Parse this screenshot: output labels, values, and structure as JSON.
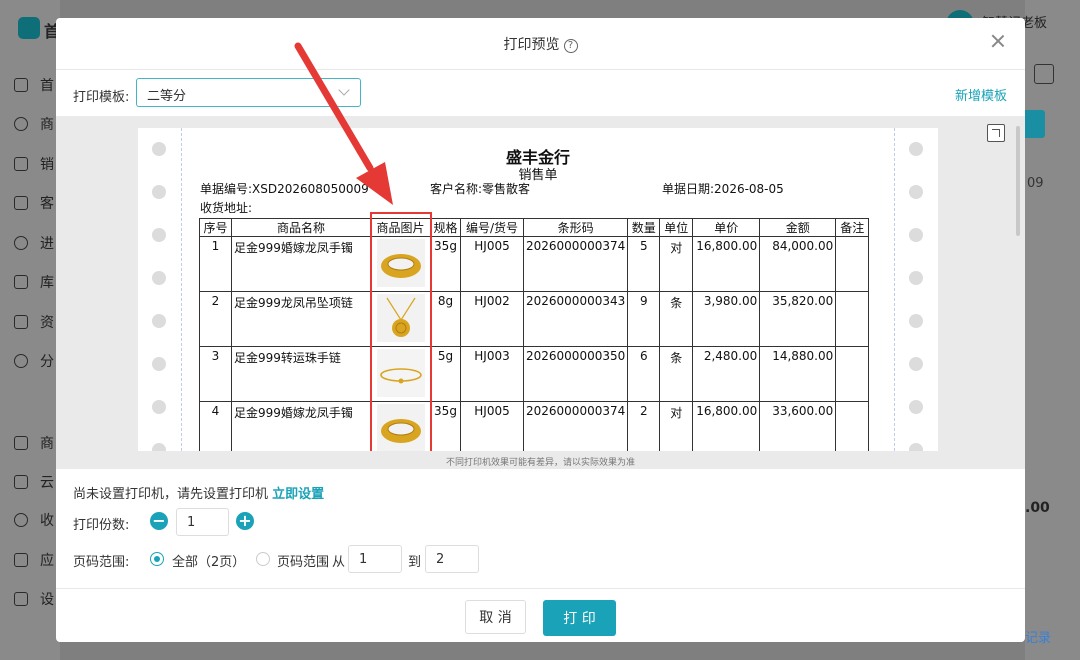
{
  "app": {
    "logo_text": "首",
    "user_name": "智慧记老板",
    "sidebar": [
      "首",
      "商",
      "销",
      "客",
      "进",
      "库",
      "资",
      "分",
      "商",
      "云",
      "收",
      "应",
      "设"
    ],
    "right_value_1": "09",
    "right_value_2": ".00",
    "right_link": "记录"
  },
  "modal": {
    "title": "打印预览",
    "help_glyph": "?",
    "template_label": "打印模板:",
    "template_value": "二等分",
    "add_template": "新增模板",
    "paper_note": "不同打印机效果可能有差异，请以实际效果为准",
    "printer_note": "尚未设置打印机，请先设置打印机",
    "printer_setup_link": "立即设置",
    "copies_label": "打印份数:",
    "copies_value": "1",
    "minus": "−",
    "plus": "+",
    "range_label": "页码范围:",
    "range_all": "全部（2页）",
    "range_custom": "页码范围",
    "range_from": "从",
    "range_to": "到",
    "page_from": "1",
    "page_to": "2",
    "cancel": "取 消",
    "print": "打 印"
  },
  "document": {
    "company": "盛丰金行",
    "doc_type": "销售单",
    "doc_no": "单据编号:XSD202608050009",
    "customer": "客户名称:零售散客",
    "date": "单据日期:2026-08-05",
    "address": "收货地址:",
    "columns": [
      "序号",
      "商品名称",
      "商品图片",
      "规格",
      "编号/货号",
      "条形码",
      "数量",
      "单位",
      "单价",
      "金额",
      "备注"
    ],
    "rows": [
      {
        "no": "1",
        "name": "足金999婚嫁龙凤手镯",
        "spec": "35g",
        "code": "HJ005",
        "barcode": "2026000000374",
        "qty": "5",
        "unit": "对",
        "price": "16,800.00",
        "amount": "84,000.00",
        "remark": "",
        "image": "gold-bangle-icon"
      },
      {
        "no": "2",
        "name": "足金999龙凤吊坠项链",
        "spec": "8g",
        "code": "HJ002",
        "barcode": "2026000000343",
        "qty": "9",
        "unit": "条",
        "price": "3,980.00",
        "amount": "35,820.00",
        "remark": "",
        "image": "gold-pendant-icon"
      },
      {
        "no": "3",
        "name": "足金999转运珠手链",
        "spec": "5g",
        "code": "HJ003",
        "barcode": "2026000000350",
        "qty": "6",
        "unit": "条",
        "price": "2,480.00",
        "amount": "14,880.00",
        "remark": "",
        "image": "gold-bracelet-icon"
      },
      {
        "no": "4",
        "name": "足金999婚嫁龙凤手镯",
        "spec": "35g",
        "code": "HJ005",
        "barcode": "2026000000374",
        "qty": "2",
        "unit": "对",
        "price": "16,800.00",
        "amount": "33,600.00",
        "remark": "",
        "image": "gold-bangle-icon"
      }
    ]
  },
  "colors": {
    "accent": "#1aa3b8",
    "highlight": "#e53935",
    "gold": "#d9a520"
  }
}
